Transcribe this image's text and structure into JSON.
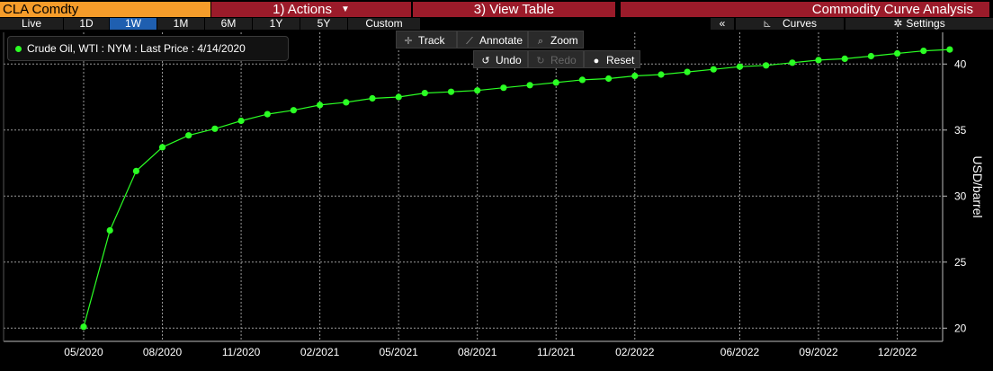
{
  "header": {
    "ticker": "CLA Comdty",
    "actions_label": "1) Actions",
    "view_table_label": "3) View Table",
    "function_title": "Commodity Curve Analysis"
  },
  "ranges": [
    "Live",
    "1D",
    "1W",
    "1M",
    "6M",
    "1Y",
    "5Y",
    "Custom"
  ],
  "active_range": "1W",
  "right_controls": {
    "collapse": "«",
    "curves": "Curves",
    "settings": "Settings"
  },
  "legend": {
    "label": "Crude Oil, WTI : NYM : Last Price : 4/14/2020"
  },
  "tools": {
    "track": "Track",
    "annotate": "Annotate",
    "zoom": "Zoom",
    "undo": "Undo",
    "redo": "Redo",
    "reset": "Reset"
  },
  "colors": {
    "series": "#2bff24",
    "ticker_bg": "#f59c2a",
    "header_bg": "#9b1b2a",
    "active_range": "#1f5fb0"
  },
  "chart_data": {
    "type": "line",
    "title": "",
    "xlabel": "",
    "ylabel": "USD/barrel",
    "ylim": [
      19.0,
      42.4
    ],
    "yticks": [
      20,
      25,
      30,
      35,
      40
    ],
    "xtick_labels": [
      "05/2020",
      "08/2020",
      "11/2020",
      "02/2021",
      "05/2021",
      "08/2021",
      "11/2021",
      "02/2022",
      "06/2022",
      "09/2022",
      "12/2022"
    ],
    "grid": true,
    "series": [
      {
        "name": "Crude Oil, WTI : NYM : Last Price : 4/14/2020",
        "x": [
          "05/2020",
          "06/2020",
          "07/2020",
          "08/2020",
          "09/2020",
          "10/2020",
          "11/2020",
          "12/2020",
          "01/2021",
          "02/2021",
          "03/2021",
          "04/2021",
          "05/2021",
          "06/2021",
          "07/2021",
          "08/2021",
          "09/2021",
          "10/2021",
          "11/2021",
          "12/2021",
          "01/2022",
          "02/2022",
          "03/2022",
          "04/2022",
          "05/2022",
          "06/2022",
          "07/2022",
          "08/2022",
          "09/2022",
          "10/2022",
          "11/2022",
          "12/2022",
          "01/2023",
          "02/2023"
        ],
        "values": [
          20.1,
          27.4,
          31.9,
          33.7,
          34.6,
          35.1,
          35.7,
          36.2,
          36.5,
          36.9,
          37.1,
          37.4,
          37.5,
          37.8,
          37.9,
          38.0,
          38.2,
          38.4,
          38.6,
          38.8,
          38.9,
          39.1,
          39.2,
          39.4,
          39.6,
          39.8,
          39.9,
          40.1,
          40.3,
          40.4,
          40.6,
          40.8,
          41.0,
          41.1
        ]
      }
    ]
  }
}
